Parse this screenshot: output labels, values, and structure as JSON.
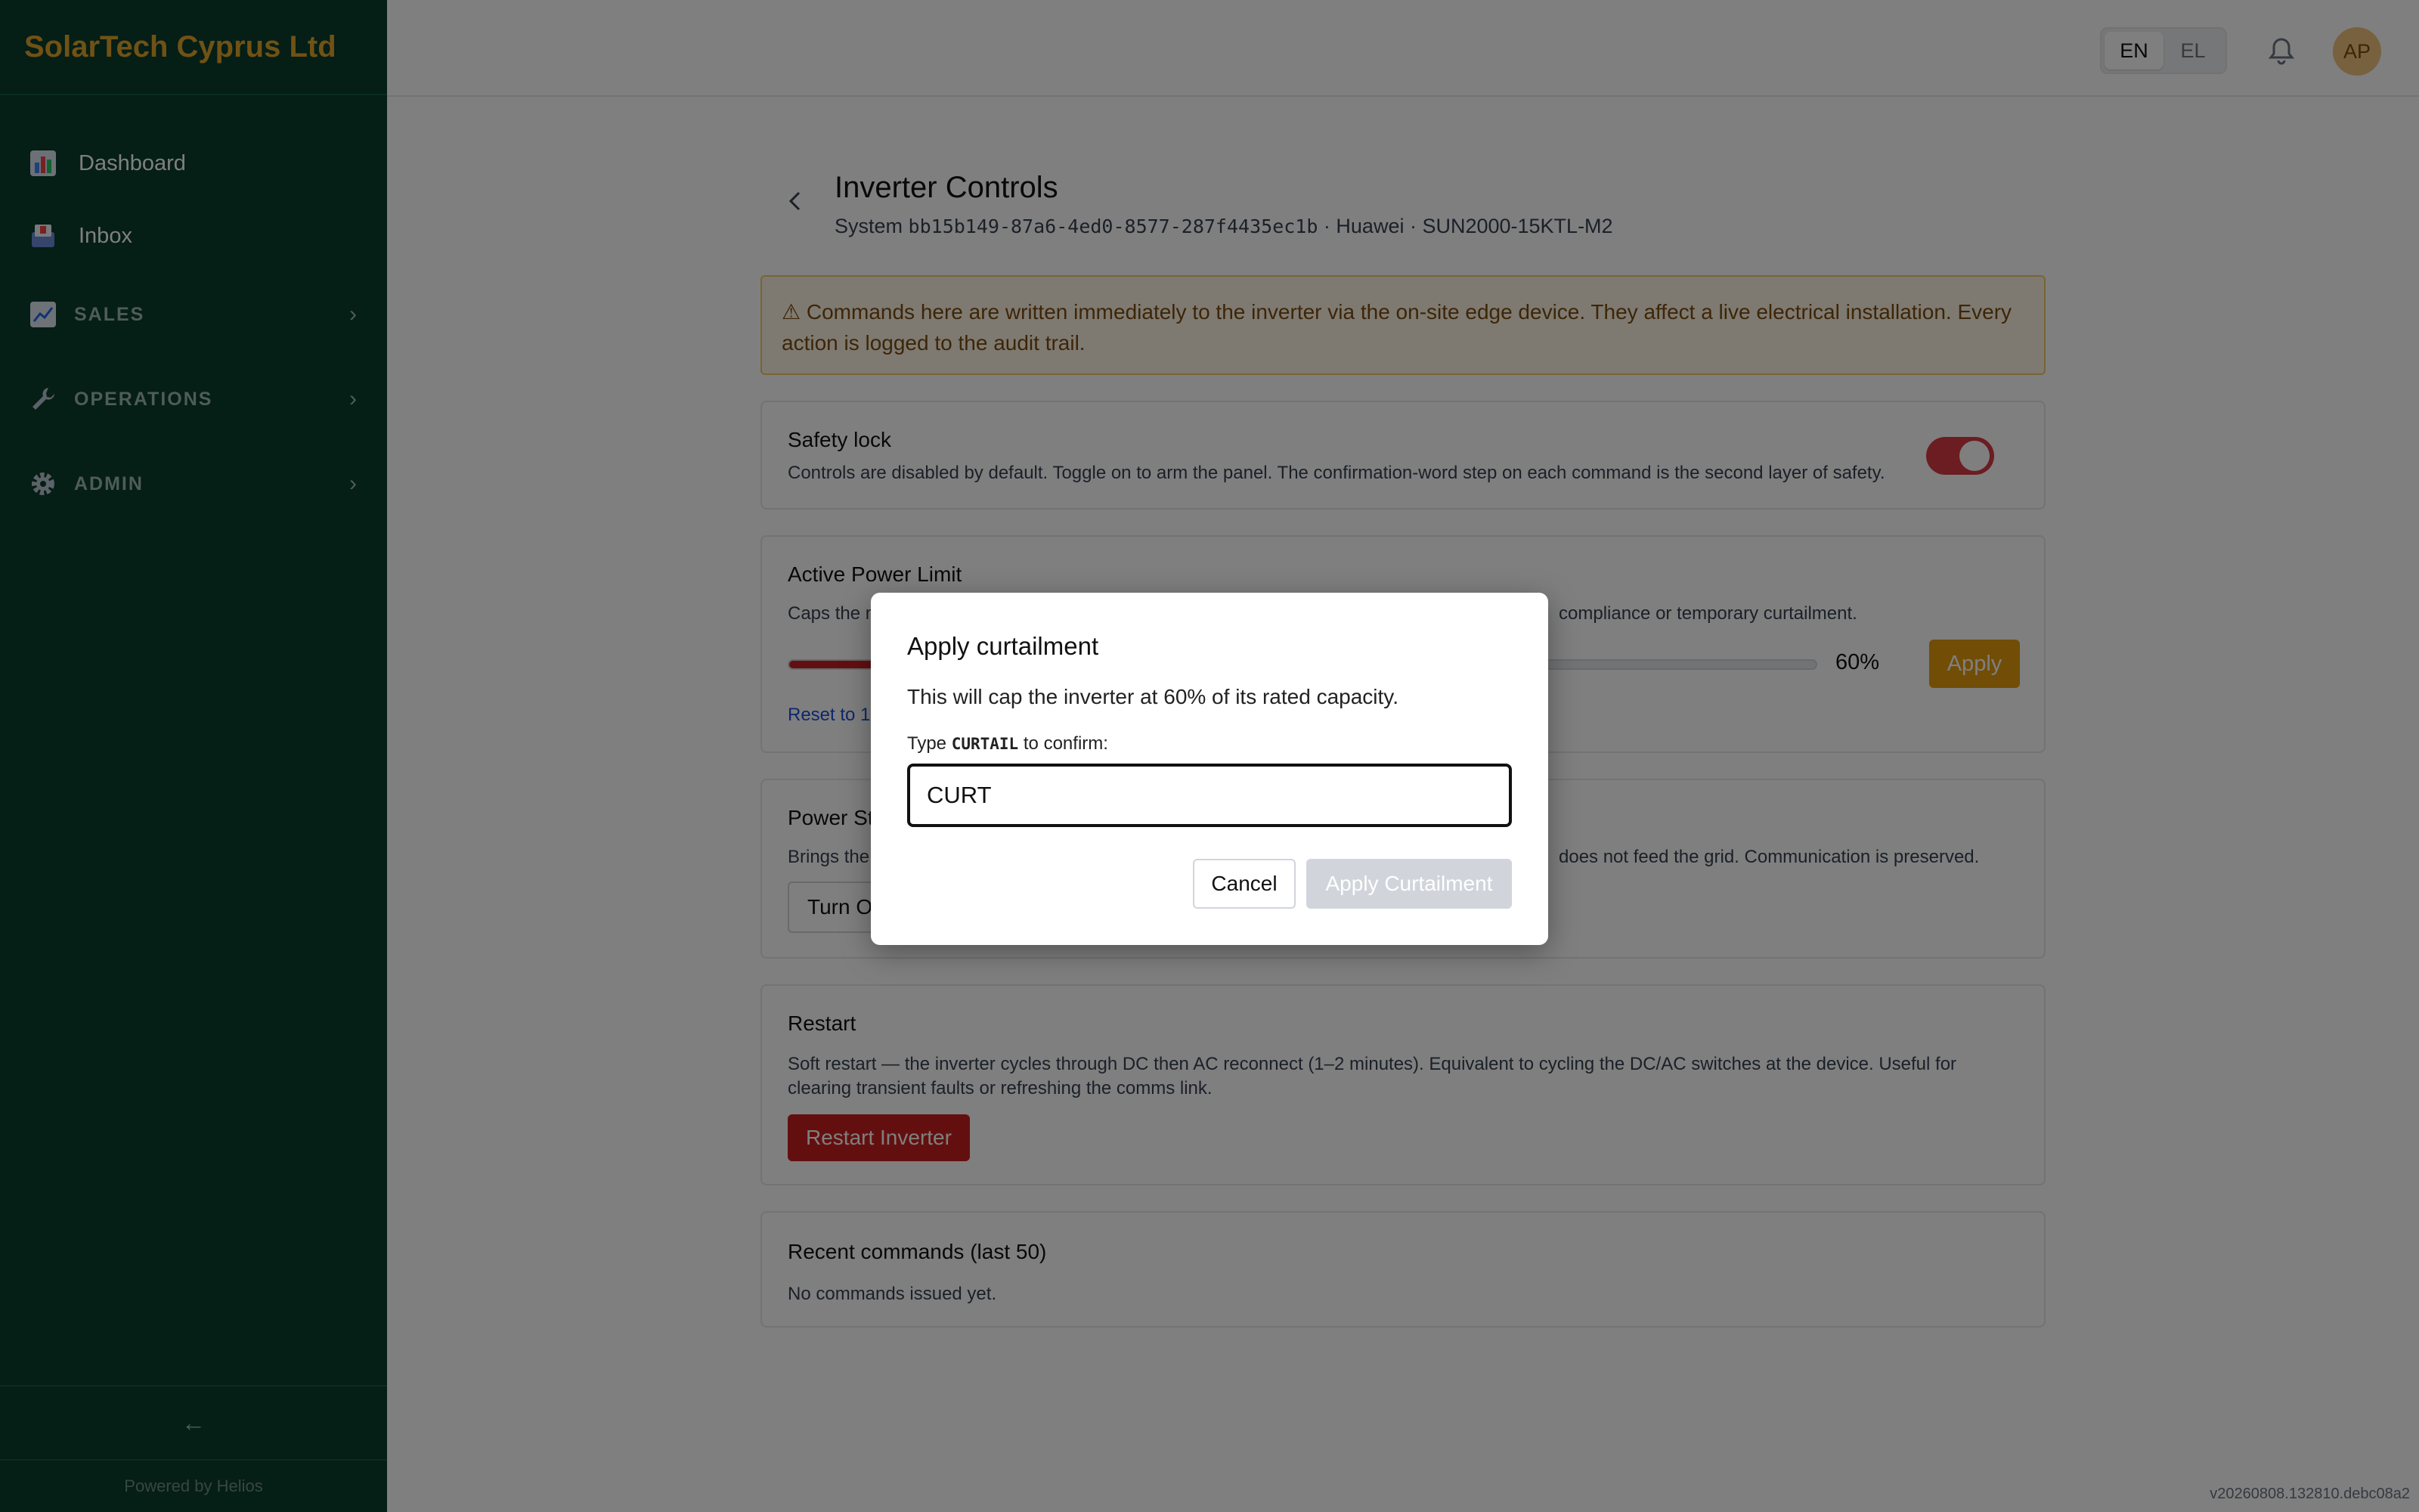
{
  "brand": "SolarTech Cyprus Ltd",
  "sidebar": {
    "items": [
      {
        "label": "Dashboard",
        "icon": "chart-icon"
      },
      {
        "label": "Inbox",
        "icon": "inbox-icon"
      }
    ],
    "sections": [
      {
        "label": "SALES",
        "icon": "trend-icon"
      },
      {
        "label": "OPERATIONS",
        "icon": "wrench-icon"
      },
      {
        "label": "ADMIN",
        "icon": "gear-icon"
      }
    ],
    "collapse_glyph": "←",
    "powered_by": "Powered by Helios"
  },
  "header": {
    "languages": [
      "EN",
      "EL"
    ],
    "active_language": "EN",
    "avatar_initials": "AP"
  },
  "page": {
    "title": "Inverter Controls",
    "subtitle_prefix": "System",
    "system_id": "bb15b149-87a6-4ed0-8577-287f4435ec1b",
    "subtitle_rest": "· Huawei · SUN2000-15KTL-M2",
    "warning": "⚠ Commands here are written immediately to the inverter via the on-site edge device. They affect a live electrical installation. Every action is logged to the audit trail."
  },
  "safety_lock": {
    "title": "Safety lock",
    "description": "Controls are disabled by default. Toggle on to arm the panel. The confirmation-word step on each command is the second layer of safety.",
    "enabled": true
  },
  "power_limit": {
    "title": "Active Power Limit",
    "description_visible_start": "Caps the m",
    "description_visible_end": "compliance or temporary curtailment.",
    "value_percent": 60,
    "value_label": "60%",
    "apply_label": "Apply",
    "reset_label": "Reset to 10"
  },
  "power_state": {
    "title": "Power St",
    "description_visible_start": "Brings the",
    "description_visible_end": "does not feed the grid. Communication is preserved.",
    "button_label": "Turn O"
  },
  "restart": {
    "title": "Restart",
    "description": "Soft restart — the inverter cycles through DC then AC reconnect (1–2 minutes). Equivalent to cycling the DC/AC switches at the device. Useful for clearing transient faults or refreshing the comms link.",
    "button_label": "Restart Inverter"
  },
  "recent": {
    "title": "Recent commands (last 50)",
    "empty": "No commands issued yet."
  },
  "modal": {
    "title": "Apply curtailment",
    "body": "This will cap the inverter at 60% of its rated capacity.",
    "label_prefix": "Type",
    "keyword": "CURTAIL",
    "label_suffix": "to confirm:",
    "input_value": "CURT",
    "cancel_label": "Cancel",
    "confirm_label": "Apply Curtailment"
  },
  "version": "v20260808.132810.debc08a2",
  "colors": {
    "sidebar_bg": "#0a3d2c",
    "brand": "#e0a42a",
    "danger": "#c81e1e",
    "accent": "#e29a0c"
  }
}
